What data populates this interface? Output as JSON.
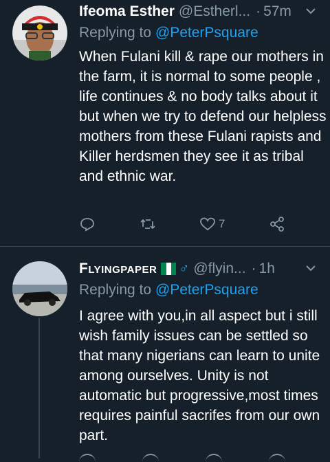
{
  "tweets": [
    {
      "name": "Ifeoma Esther",
      "handle": "@Estherl...",
      "time": "57m",
      "replying_prefix": "Replying to ",
      "replying_to": "@PeterPsquare",
      "text": "When Fulani kill & rape our mothers in the farm, it is normal to some people , life continues & no body talks about it but when we try to defend our helpless mothers from these Fulani rapists and Killer herdsmen they see it as tribal and ethnic war.",
      "likes": "7"
    },
    {
      "name": "Flyingpaper",
      "handle": "@flyin...",
      "time": "1h",
      "replying_prefix": "Replying to ",
      "replying_to": "@PeterPsquare",
      "text": "I agree with you,in all aspect but i still wish family issues can be settled so that many nigerians can learn to unite among ourselves. Unity is not automatic but progressive,most times requires painful sacrifes from our own part."
    }
  ],
  "colors": {
    "background": "#15202b",
    "secondary_text": "#8899a6",
    "link": "#1da1f2",
    "divider": "#38444d"
  },
  "icons": [
    "reply-icon",
    "retweet-icon",
    "like-icon",
    "share-icon",
    "chevron-down-icon",
    "nigeria-flag-icon",
    "male-sign-icon"
  ]
}
